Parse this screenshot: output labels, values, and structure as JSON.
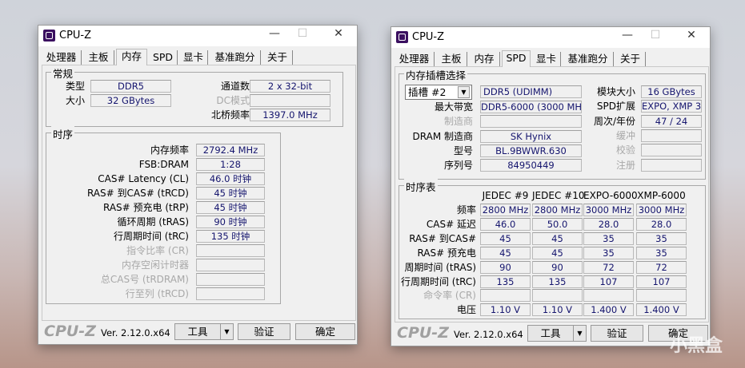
{
  "app_title": "CPU-Z",
  "tabs": [
    "处理器",
    "主板",
    "内存",
    "SPD",
    "显卡",
    "基准跑分",
    "关于"
  ],
  "footer": {
    "logo": "CPU-Z",
    "version": "Ver. 2.12.0.x64",
    "tools": "工具",
    "validate": "验证",
    "ok": "确定"
  },
  "memory_window": {
    "active_tab": "内存",
    "general": {
      "title": "常规",
      "left": [
        {
          "label": "类型",
          "value": "DDR5"
        },
        {
          "label": "大小",
          "value": "32 GBytes"
        }
      ],
      "right": [
        {
          "label": "通道数",
          "value": "2 x 32-bit",
          "dim": false
        },
        {
          "label": "DC模式",
          "value": "",
          "dim": true
        },
        {
          "label": "北桥频率",
          "value": "1397.0 MHz",
          "dim": false
        }
      ]
    },
    "timings": {
      "title": "时序",
      "rows": [
        {
          "label": "内存频率",
          "value": "2792.4 MHz"
        },
        {
          "label": "FSB:DRAM",
          "value": "1:28"
        },
        {
          "label": "CAS# Latency (CL)",
          "value": "46.0 时钟"
        },
        {
          "label": "RAS# 到CAS# (tRCD)",
          "value": "45 时钟"
        },
        {
          "label": "RAS# 预充电 (tRP)",
          "value": "45 时钟"
        },
        {
          "label": "循环周期 (tRAS)",
          "value": "90 时钟"
        },
        {
          "label": "行周期时间 (tRC)",
          "value": "135 时钟"
        },
        {
          "label": "指令比率 (CR)",
          "value": "",
          "dim": true
        },
        {
          "label": "内存空闲计时器",
          "value": "",
          "dim": true
        },
        {
          "label": "总CAS号 (tRDRAM)",
          "value": "",
          "dim": true
        },
        {
          "label": "行至列 (tRCD)",
          "value": "",
          "dim": true
        }
      ]
    }
  },
  "spd_window": {
    "active_tab": "SPD",
    "slot": {
      "title": "内存插槽选择",
      "selected": "插槽 #2",
      "module_type": "DDR5 (UDIMM)",
      "left": [
        {
          "label": "最大带宽",
          "value": "DDR5-6000 (3000 MHz)"
        },
        {
          "label": "制造商",
          "value": "",
          "dim": true
        },
        {
          "label": "DRAM 制造商",
          "value": "SK Hynix"
        },
        {
          "label": "型号",
          "value": "BL.9BWWR.630"
        },
        {
          "label": "序列号",
          "value": "84950449"
        }
      ],
      "right": [
        {
          "label": "模块大小",
          "value": "16 GBytes"
        },
        {
          "label": "SPD扩展",
          "value": "EXPO, XMP 3.0"
        },
        {
          "label": "周次/年份",
          "value": "47 / 24"
        },
        {
          "label": "缓冲",
          "value": "",
          "dim": true
        },
        {
          "label": "校验",
          "value": "",
          "dim": true
        },
        {
          "label": "注册",
          "value": "",
          "dim": true
        }
      ]
    },
    "timing_table": {
      "title": "时序表",
      "columns": [
        "JEDEC #9",
        "JEDEC #10",
        "EXPO-6000",
        "XMP-6000"
      ],
      "rows": [
        {
          "label": "频率",
          "values": [
            "2800 MHz",
            "2800 MHz",
            "3000 MHz",
            "3000 MHz"
          ]
        },
        {
          "label": "CAS# 延迟",
          "values": [
            "46.0",
            "50.0",
            "28.0",
            "28.0"
          ]
        },
        {
          "label": "RAS# 到CAS#",
          "values": [
            "45",
            "45",
            "35",
            "35"
          ]
        },
        {
          "label": "RAS# 预充电",
          "values": [
            "45",
            "45",
            "35",
            "35"
          ]
        },
        {
          "label": "周期时间 (tRAS)",
          "values": [
            "90",
            "90",
            "72",
            "72"
          ]
        },
        {
          "label": "行周期时间 (tRC)",
          "values": [
            "135",
            "135",
            "107",
            "107"
          ]
        },
        {
          "label": "命令率 (CR)",
          "values": [
            "",
            "",
            "",
            ""
          ],
          "dim": true
        },
        {
          "label": "电压",
          "values": [
            "1.10 V",
            "1.10 V",
            "1.400 V",
            "1.400 V"
          ]
        }
      ]
    }
  },
  "watermark": "小黑盒"
}
